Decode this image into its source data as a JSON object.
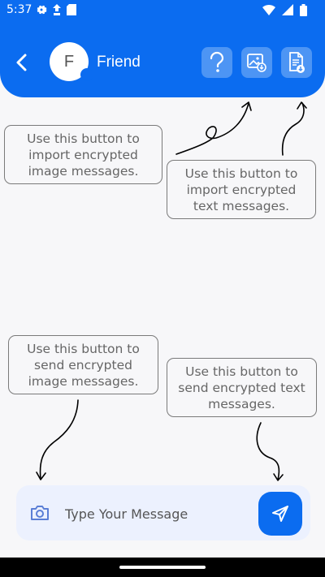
{
  "status_bar": {
    "time": "5:37",
    "left_icons": [
      "settings-gear-icon",
      "navigation-icon",
      "sd-card-icon"
    ],
    "right_icons": [
      "wifi-icon",
      "signal-icon",
      "battery-icon"
    ]
  },
  "header": {
    "avatar_initial": "F",
    "contact_name": "Friend",
    "buttons": [
      "help-icon",
      "import-image-icon",
      "import-text-icon"
    ],
    "background_color": "#0b6cf0",
    "button_color": "#4d95f4"
  },
  "tooltips": {
    "import_image": "Use this button to import encrypted image messages.",
    "import_text": "Use this button to import encrypted text messages.",
    "send_image": "Use this button to send encrypted image messages.",
    "send_text": "Use this button to send encrypted text messages."
  },
  "composer": {
    "placeholder": "Type Your Message",
    "value": ""
  },
  "colors": {
    "accent": "#0b6cf0",
    "composer_bg": "#ecf1fe",
    "page_bg": "#f7f7f9"
  }
}
